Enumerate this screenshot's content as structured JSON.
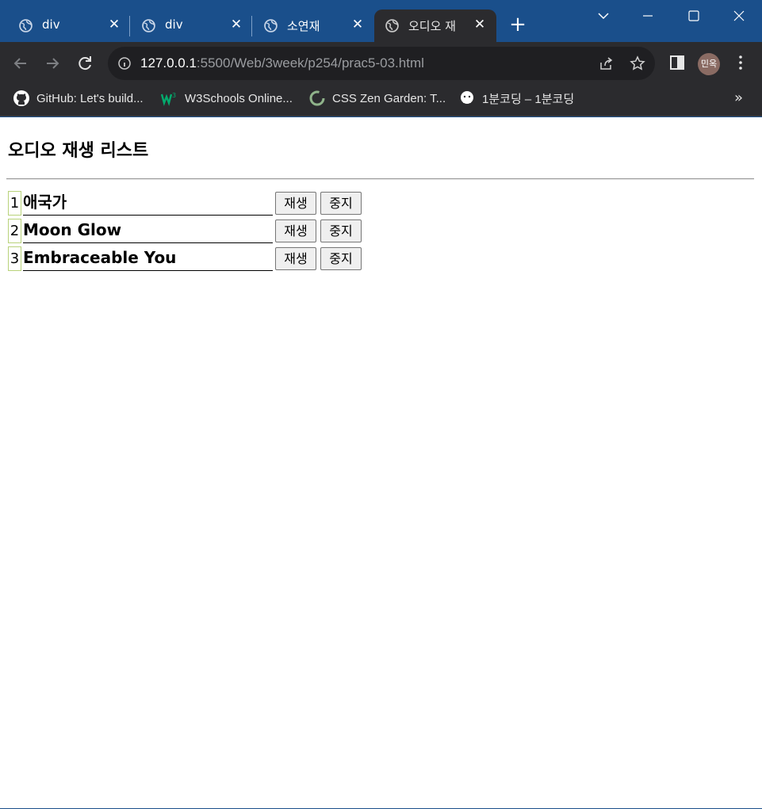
{
  "browser": {
    "tabs": [
      {
        "title": "div",
        "active": false
      },
      {
        "title": "div",
        "active": false
      },
      {
        "title": "소연재",
        "active": false
      },
      {
        "title": "오디오 재",
        "active": true
      }
    ],
    "new_tab_label": "+",
    "url_host": "127.0.0.1",
    "url_rest": ":5500/Web/3week/p254/prac5-03.html",
    "profile_initials": "민옥",
    "bookmarks": [
      {
        "label": "GitHub: Let's build...",
        "icon": "github-icon"
      },
      {
        "label": "W3Schools Online...",
        "icon": "w3schools-icon"
      },
      {
        "label": "CSS Zen Garden: T...",
        "icon": "csszengarden-icon"
      },
      {
        "label": "1분코딩 – 1분코딩",
        "icon": "1bun-coding-icon"
      }
    ],
    "bookmarks_overflow": "»",
    "colors": {
      "frame": "#1a4f8b",
      "toolbar": "#2b2b2e",
      "omnibox": "#1f1f22"
    }
  },
  "page": {
    "title": "오디오 재생 리스트",
    "tracks": [
      {
        "number": "1",
        "name": "애국가",
        "play_label": "재생",
        "stop_label": "중지"
      },
      {
        "number": "2",
        "name": "Moon Glow",
        "play_label": "재생",
        "stop_label": "중지"
      },
      {
        "number": "3",
        "name": "Embraceable You",
        "play_label": "재생",
        "stop_label": "중지"
      }
    ]
  }
}
